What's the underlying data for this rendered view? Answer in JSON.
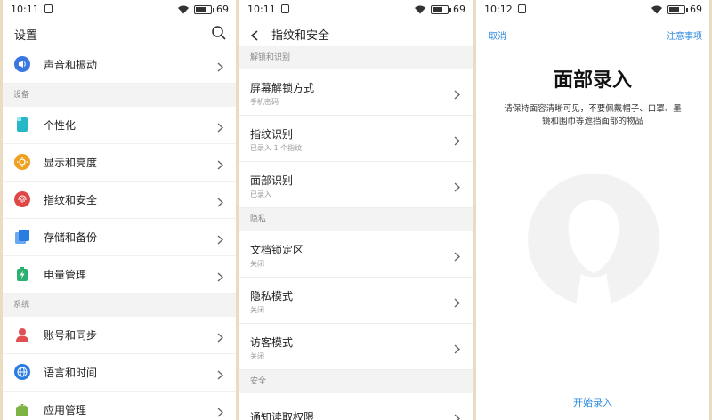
{
  "status": {
    "time1": "10:11",
    "time2": "10:11",
    "time3": "10:12",
    "battery": "69"
  },
  "settings": {
    "title": "设置",
    "items_top": [
      {
        "label": "声音和振动",
        "icon": "speaker-icon",
        "color": "#3a78e0"
      }
    ],
    "section_device": "设备",
    "items_device": [
      {
        "label": "个性化",
        "icon": "personalize-icon",
        "color": "#27b8c8"
      },
      {
        "label": "显示和亮度",
        "icon": "sun-icon",
        "color": "#f0a020"
      },
      {
        "label": "指纹和安全",
        "icon": "fingerprint-icon",
        "color": "#e04848"
      },
      {
        "label": "存储和备份",
        "icon": "storage-icon",
        "color": "#2a7de0"
      },
      {
        "label": "电量管理",
        "icon": "battery-icon",
        "color": "#2bb070"
      }
    ],
    "section_system": "系统",
    "items_system": [
      {
        "label": "账号和同步",
        "icon": "account-icon",
        "color": "#e05050"
      },
      {
        "label": "语言和时间",
        "icon": "globe-icon",
        "color": "#2a7de0"
      },
      {
        "label": "应用管理",
        "icon": "android-icon",
        "color": "#7cb342"
      }
    ]
  },
  "security": {
    "title": "指纹和安全",
    "section_unlock": "解锁和识别",
    "items_unlock": [
      {
        "label": "屏幕解锁方式",
        "sub": "手机密码"
      },
      {
        "label": "指纹识别",
        "sub": "已录入 1 个指纹"
      },
      {
        "label": "面部识别",
        "sub": "已录入"
      }
    ],
    "section_privacy": "隐私",
    "items_privacy": [
      {
        "label": "文档锁定区",
        "sub": "关闭"
      },
      {
        "label": "隐私模式",
        "sub": "关闭"
      },
      {
        "label": "访客模式",
        "sub": "关闭"
      }
    ],
    "section_safety": "安全",
    "items_safety": [
      {
        "label": "通知读取权限",
        "sub": ""
      }
    ]
  },
  "face": {
    "cancel": "取消",
    "notice": "注意事项",
    "title": "面部录入",
    "desc": "请保持面容清晰可见，不要佩戴帽子、口罩、墨镜和围巾等遮挡面部的物品",
    "start": "开始录入"
  },
  "colors": {
    "accent": "#2f8be0"
  }
}
